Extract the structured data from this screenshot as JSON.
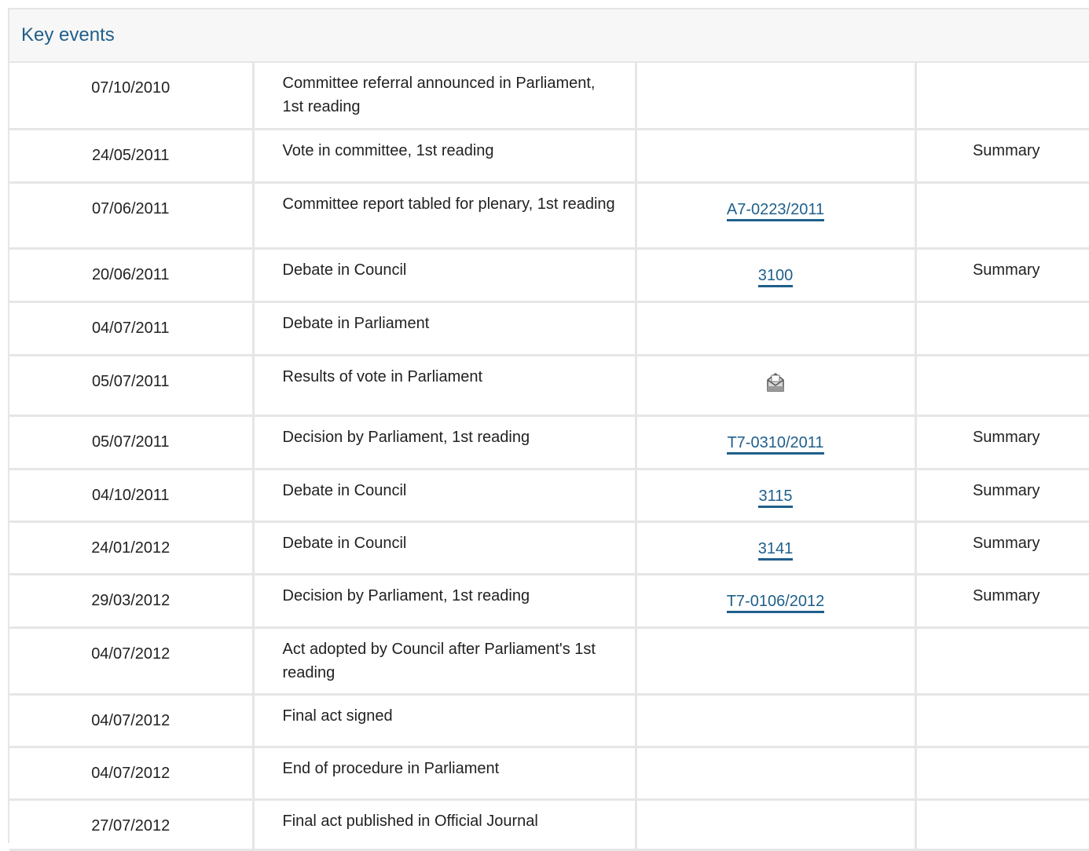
{
  "panel": {
    "title": "Key events"
  },
  "rows": [
    {
      "date": "07/10/2010",
      "event": "Committee referral announced in Parliament, 1st reading",
      "doc": "",
      "summary": ""
    },
    {
      "date": "24/05/2011",
      "event": "Vote in committee, 1st reading",
      "doc": "",
      "summary": "Summary"
    },
    {
      "date": "07/06/2011",
      "event": "Committee report tabled for plenary, 1st reading",
      "doc": "A7-0223/2011",
      "summary": ""
    },
    {
      "date": "20/06/2011",
      "event": "Debate in Council",
      "doc": "3100",
      "summary": "Summary"
    },
    {
      "date": "04/07/2011",
      "event": "Debate in Parliament",
      "doc": "",
      "summary": ""
    },
    {
      "date": "05/07/2011",
      "event": "Results of vote in Parliament",
      "doc_icon": "ballot-box-icon",
      "doc": "",
      "summary": ""
    },
    {
      "date": "05/07/2011",
      "event": "Decision by Parliament, 1st reading",
      "doc": "T7-0310/2011",
      "summary": "Summary"
    },
    {
      "date": "04/10/2011",
      "event": "Debate in Council",
      "doc": "3115",
      "summary": "Summary"
    },
    {
      "date": "24/01/2012",
      "event": "Debate in Council",
      "doc": "3141",
      "summary": "Summary"
    },
    {
      "date": "29/03/2012",
      "event": "Decision by Parliament, 1st reading",
      "doc": "T7-0106/2012",
      "summary": "Summary"
    },
    {
      "date": "04/07/2012",
      "event": "Act adopted by Council after Parliament's 1st reading",
      "doc": "",
      "summary": ""
    },
    {
      "date": "04/07/2012",
      "event": "Final act signed",
      "doc": "",
      "summary": ""
    },
    {
      "date": "04/07/2012",
      "event": "End of procedure in Parliament",
      "doc": "",
      "summary": ""
    },
    {
      "date": "27/07/2012",
      "event": "Final act published in Official Journal",
      "doc": "",
      "summary": ""
    }
  ],
  "colors": {
    "link": "#1f5f8b",
    "border": "#e6e6e6",
    "header_bg": "#f7f7f7"
  }
}
